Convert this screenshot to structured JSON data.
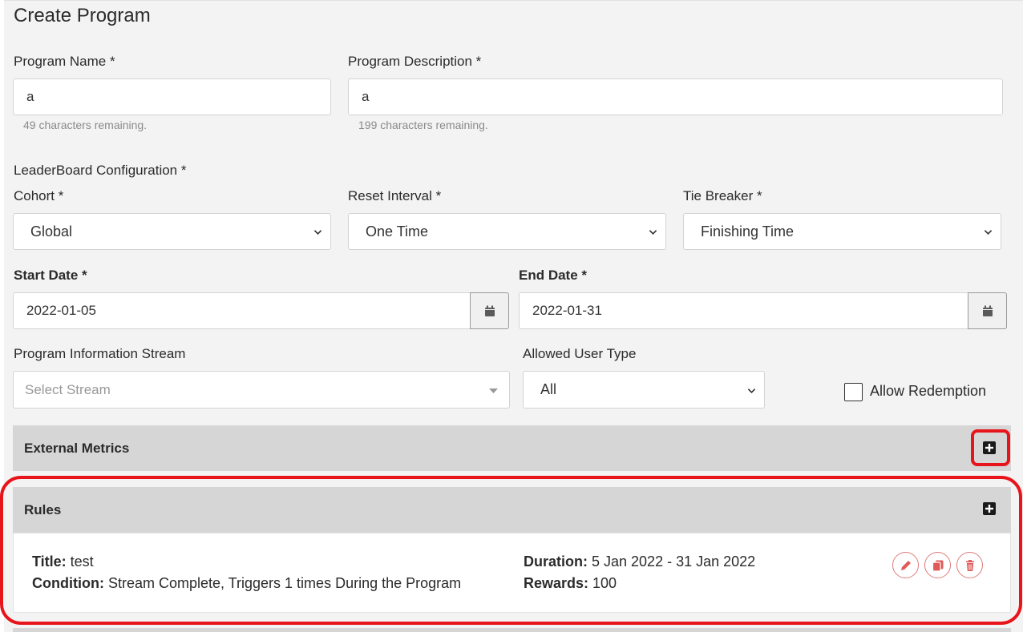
{
  "page_title": "Create Program",
  "program_name": {
    "label": "Program Name *",
    "value": "a",
    "hint": "49 characters remaining."
  },
  "program_description": {
    "label": "Program Description *",
    "value": "a",
    "hint": "199 characters remaining."
  },
  "leaderboard": {
    "heading": "LeaderBoard Configuration *",
    "cohort": {
      "label": "Cohort *",
      "value": "Global"
    },
    "reset_interval": {
      "label": "Reset Interval *",
      "value": "One Time"
    },
    "tie_breaker": {
      "label": "Tie Breaker *",
      "value": "Finishing Time"
    }
  },
  "start_date": {
    "label": "Start Date *",
    "value": "2022-01-05"
  },
  "end_date": {
    "label": "End Date *",
    "value": "2022-01-31"
  },
  "info_stream": {
    "label": "Program Information Stream",
    "placeholder": "Select Stream"
  },
  "user_type": {
    "label": "Allowed User Type",
    "value": "All"
  },
  "allow_redemption": {
    "label": "Allow Redemption",
    "checked": false
  },
  "external_metrics": {
    "title": "External Metrics"
  },
  "rules": {
    "title": "Rules",
    "items": [
      {
        "title_label": "Title:",
        "title_value": " test",
        "condition_label": "Condition:",
        "condition_value": " Stream Complete, Triggers 1 times During the Program",
        "duration_label": "Duration:",
        "duration_value": " 5 Jan 2022 - 31 Jan 2022",
        "rewards_label": "Rewards:",
        "rewards_value": " 100"
      }
    ]
  },
  "colors": {
    "highlight": "#e8141b",
    "action_icon": "#e05a5a",
    "panel_header": "#d6d6d6"
  }
}
